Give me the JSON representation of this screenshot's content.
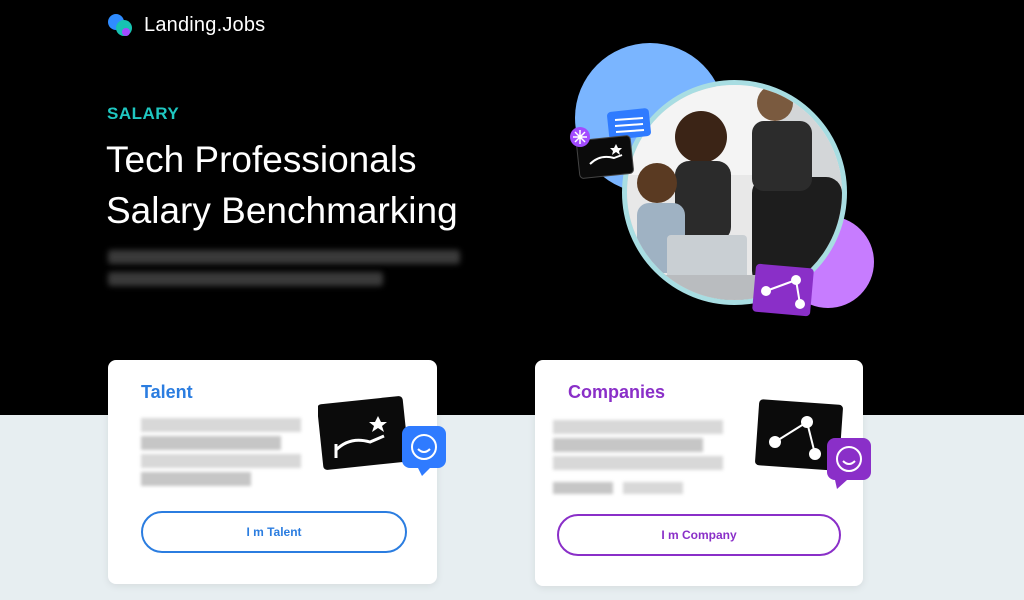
{
  "brand": {
    "name": "Landing.Jobs"
  },
  "hero": {
    "eyebrow": "SALARY",
    "title_line1": "Tech Professionals",
    "title_line2": "Salary Benchmarking"
  },
  "cards": {
    "talent": {
      "title": "Talent",
      "button": "I m Talent",
      "accent": "#2b7de0",
      "icon": "hand-star-icon",
      "badge_icon": "chat-smile-icon"
    },
    "company": {
      "title": "Companies",
      "button": "I m Company",
      "accent": "#8a2fc8",
      "icon": "network-check-icon",
      "badge_icon": "chat-smile-icon"
    }
  },
  "colors": {
    "hero_bg": "#000000",
    "page_bg": "#e7eef1",
    "eyebrow": "#1fc7c1",
    "blob_blue": "#7ab5ff",
    "blob_purple": "#c77cff",
    "ring": "#a8dde2"
  }
}
